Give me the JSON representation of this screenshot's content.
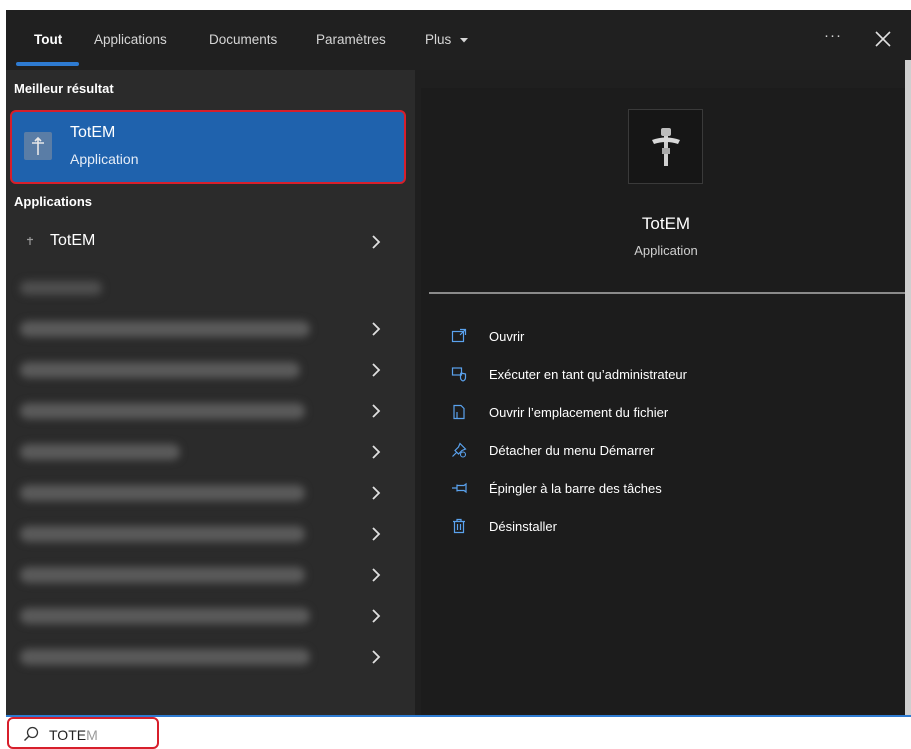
{
  "tabs": [
    {
      "label": "Tout",
      "active": true
    },
    {
      "label": "Applications"
    },
    {
      "label": "Documents"
    },
    {
      "label": "Paramètres"
    },
    {
      "label": "Plus"
    }
  ],
  "header": {
    "more_label": "···"
  },
  "left": {
    "best_section_label": "Meilleur résultat",
    "best": {
      "title": "TotEM",
      "subtitle": "Application"
    },
    "apps_section_label": "Applications",
    "app_name": "TotEM"
  },
  "detail": {
    "title": "TotEM",
    "subtitle": "Application",
    "actions": [
      {
        "label": "Ouvrir",
        "icon": "open-window-icon"
      },
      {
        "label": "Exécuter en tant qu’administrateur",
        "icon": "shield-icon"
      },
      {
        "label": "Ouvrir l’emplacement du fichier",
        "icon": "file-location-icon"
      },
      {
        "label": "Détacher du menu Démarrer",
        "icon": "unpin-icon"
      },
      {
        "label": "Épingler à la barre des tâches",
        "icon": "pin-taskbar-icon"
      },
      {
        "label": "Désinstaller",
        "icon": "trash-icon"
      }
    ]
  },
  "search": {
    "typed": "TOTE",
    "suggestion": "M"
  },
  "colors": {
    "accent": "#2e7bd1",
    "highlight_border": "#d71f2b",
    "selected_bg": "#1f62ad"
  }
}
